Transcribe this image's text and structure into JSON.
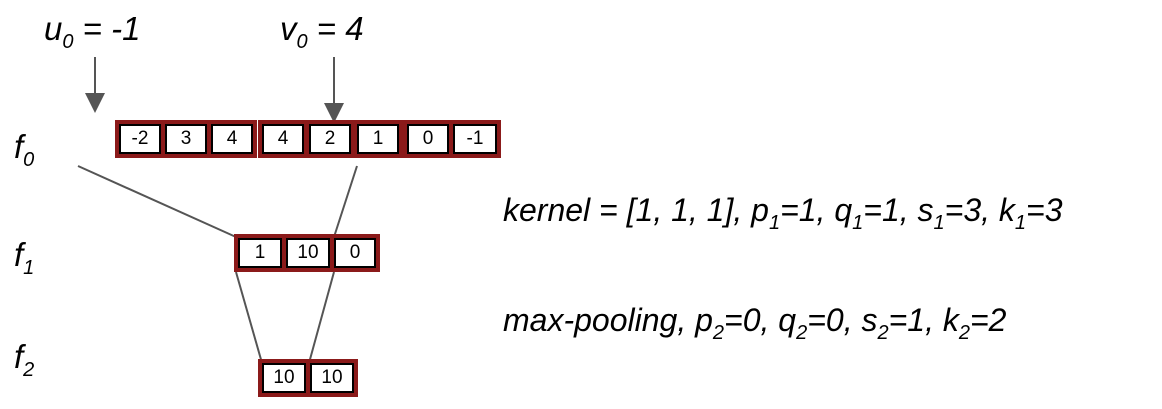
{
  "labels": {
    "u0_var": "u",
    "u0_sub": "0",
    "u0_eq": " = -1",
    "v0_var": "v",
    "v0_sub": "0",
    "v0_eq": " = 4",
    "f0_var": "f",
    "f0_sub": "0",
    "f1_var": "f",
    "f1_sub": "1",
    "f2_var": "f",
    "f2_sub": "2"
  },
  "layers": {
    "f0": [
      "-2",
      "3",
      "4",
      "4",
      "2",
      "1",
      "0",
      "-1"
    ],
    "f1": [
      "1",
      "10",
      "0"
    ],
    "f2": [
      "10",
      "10"
    ]
  },
  "annotations": {
    "layer1": {
      "a": "kernel = [1, 1, 1], p",
      "a_sub": "1",
      "b": "=1, q",
      "b_sub": "1",
      "c": "=1, s",
      "c_sub": "1",
      "d": "=3, k",
      "d_sub": "1",
      "e": "=3"
    },
    "layer2": {
      "a": "max-pooling, p",
      "a_sub": "2",
      "b": "=0, q",
      "b_sub": "2",
      "c": "=0, s",
      "c_sub": "2",
      "d": "=1, k",
      "d_sub": "2",
      "e": "=2"
    }
  },
  "colors": {
    "cell_border": "#8b1a1a",
    "line": "#555555"
  }
}
